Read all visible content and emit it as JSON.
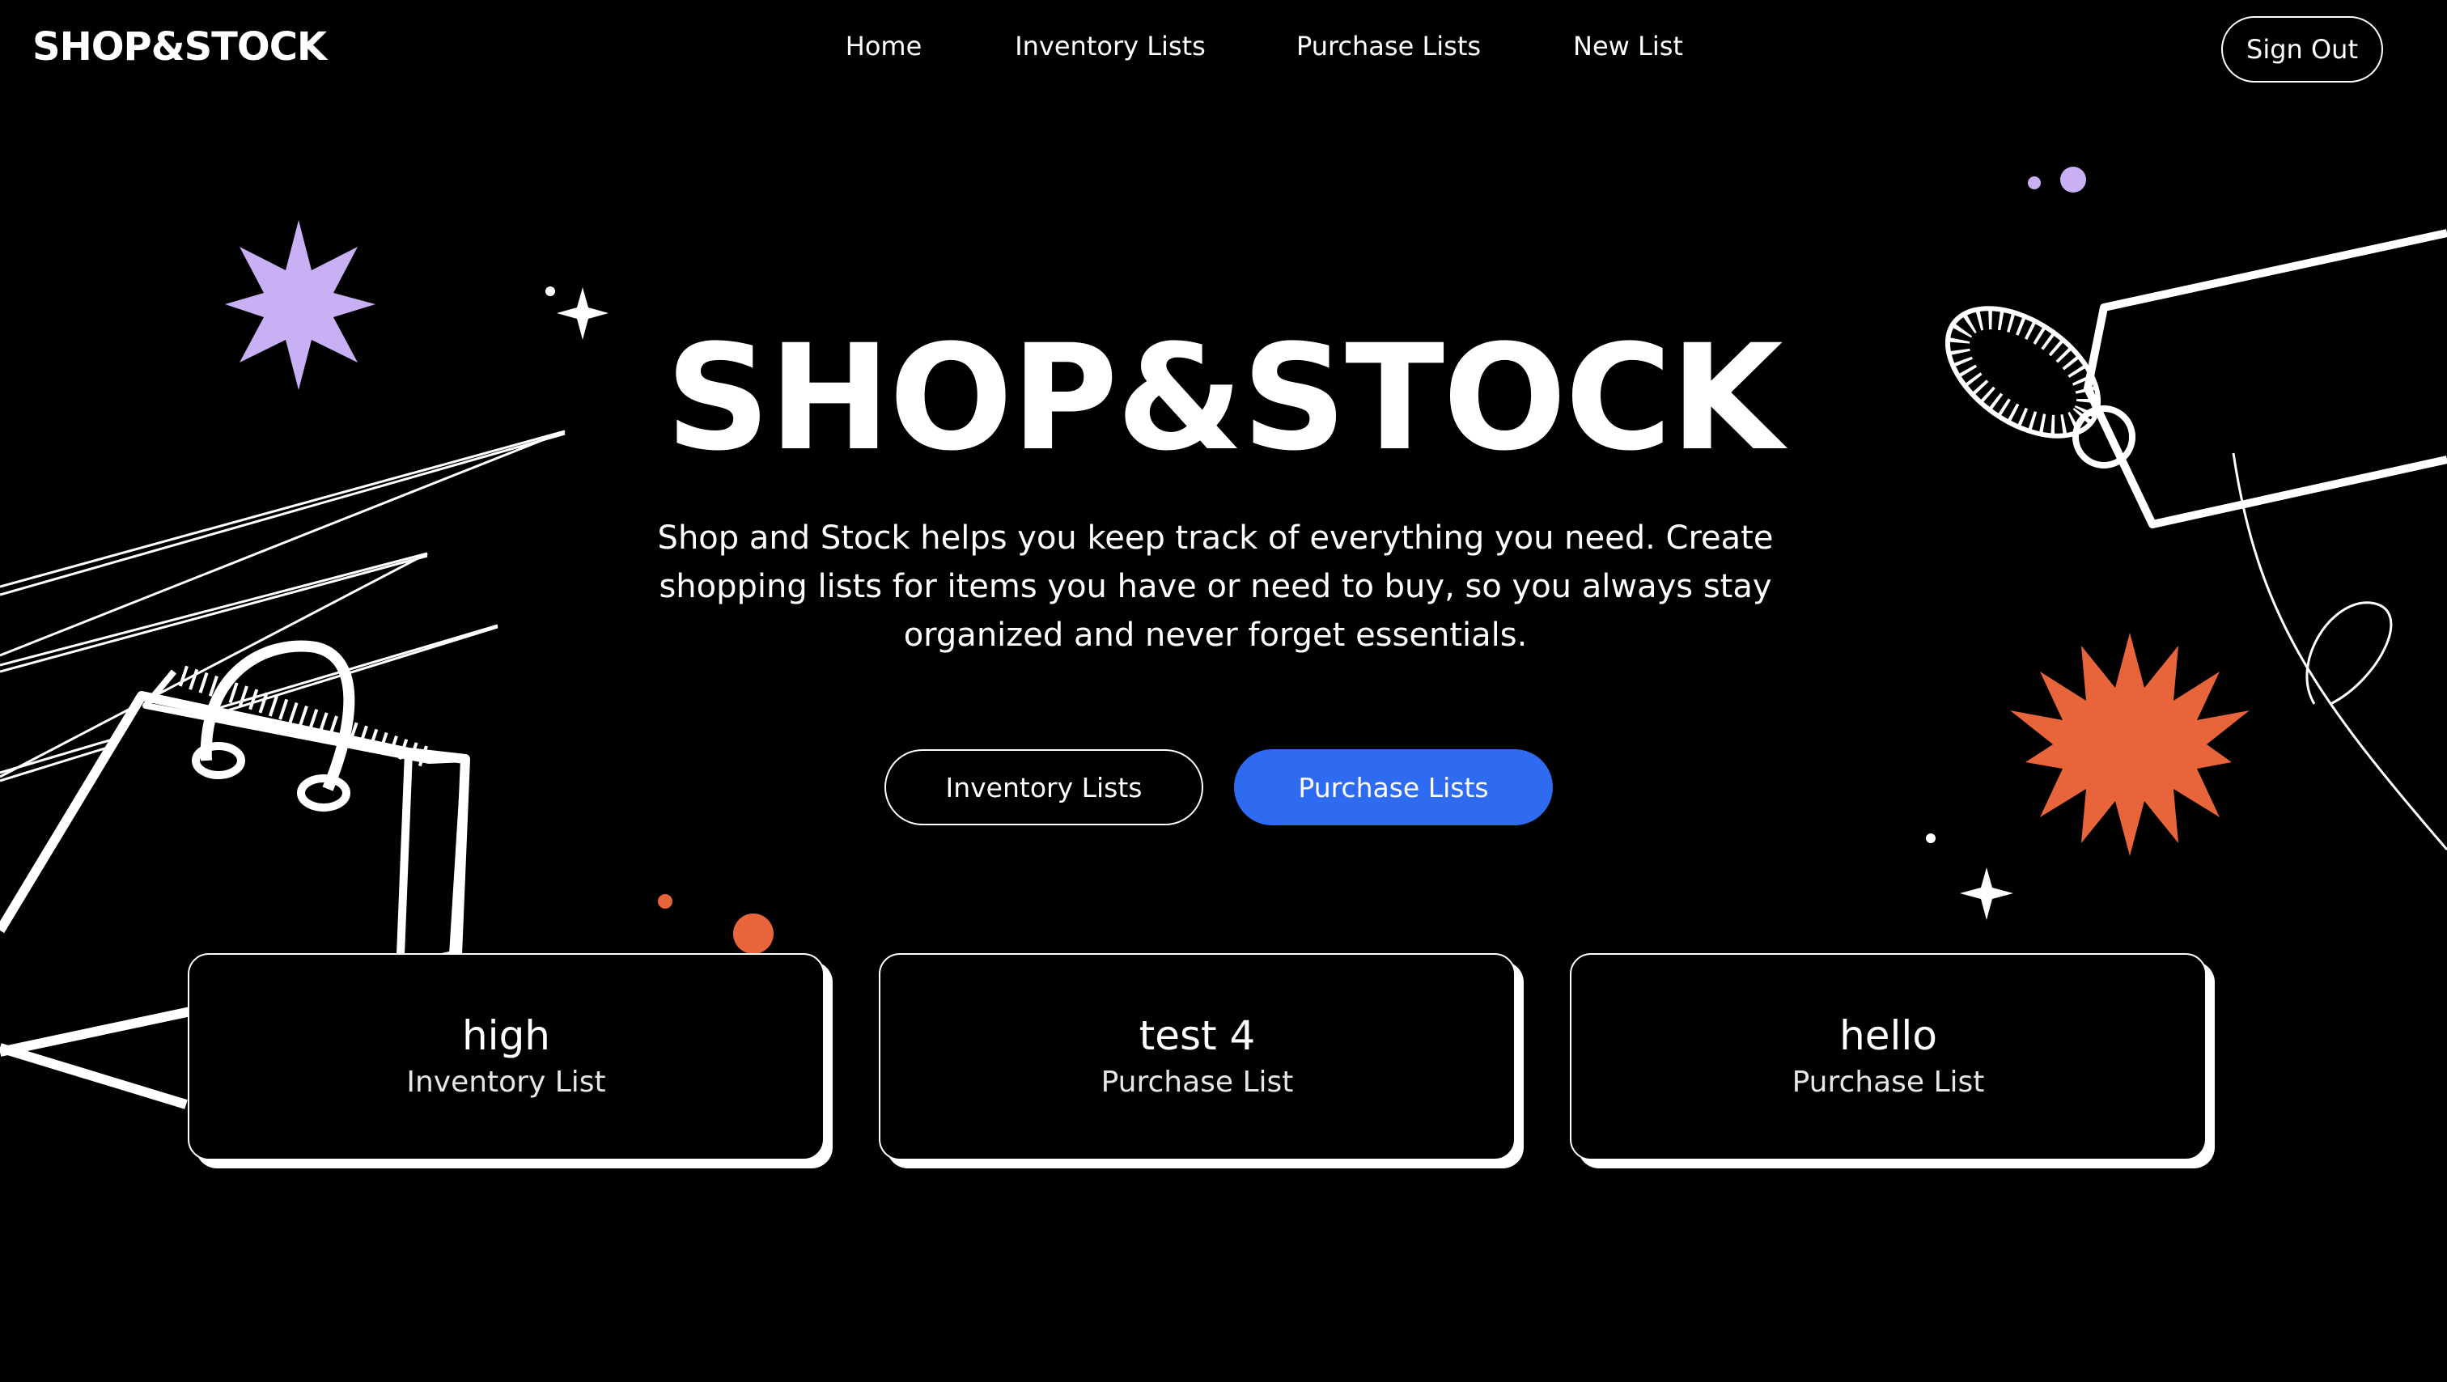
{
  "header": {
    "logo": "SHOP&STOCK",
    "nav": [
      {
        "label": "Home"
      },
      {
        "label": "Inventory Lists"
      },
      {
        "label": "Purchase Lists"
      },
      {
        "label": "New List"
      }
    ],
    "sign_out": "Sign Out"
  },
  "hero": {
    "title": "SHOP&STOCK",
    "description": "Shop and Stock helps you keep track of everything you need. Create shopping lists for items you have or need to buy, so you always stay organized and never forget essentials.",
    "buttons": {
      "inventory": "Inventory Lists",
      "purchase": "Purchase Lists"
    }
  },
  "cards": [
    {
      "title": "high",
      "type": "Inventory List"
    },
    {
      "title": "test 4",
      "type": "Purchase List"
    },
    {
      "title": "hello",
      "type": "Purchase List"
    }
  ],
  "colors": {
    "background": "#000000",
    "primary_button": "#2f6bf0",
    "accent_purple": "#c9b0f5",
    "accent_orange": "#e8643a"
  },
  "icons": [
    "sparkle-star-icon",
    "shopping-bag-illustration",
    "price-tag-illustration",
    "burst-star-icon"
  ]
}
